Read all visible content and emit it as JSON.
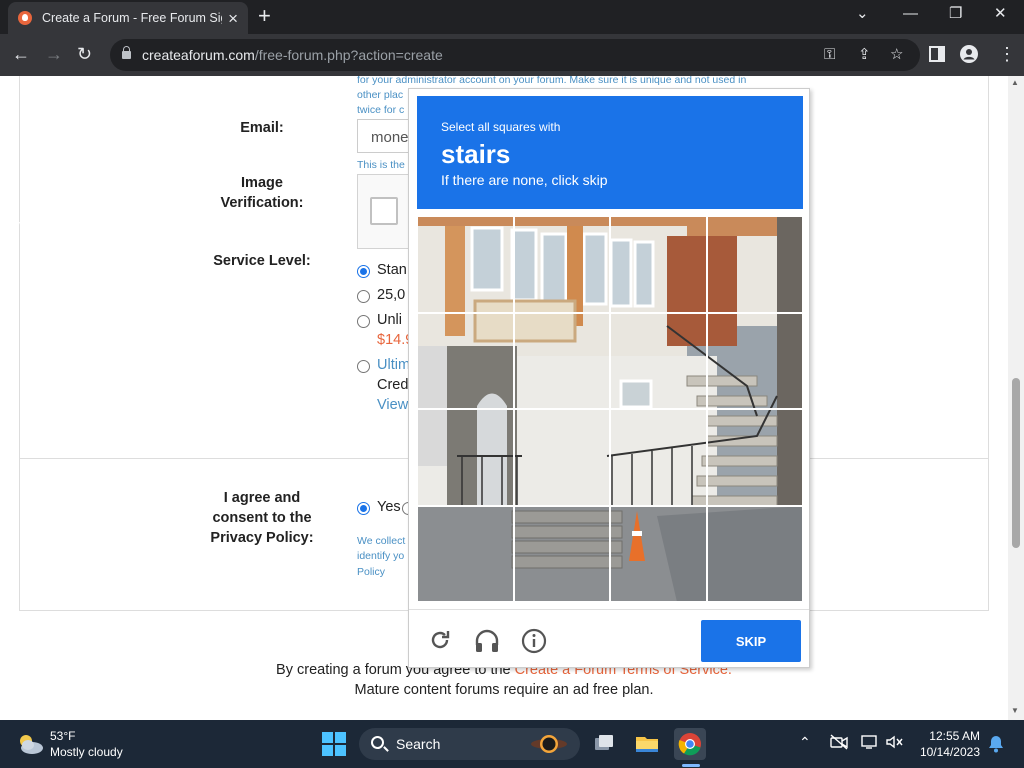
{
  "browser": {
    "tab_title": "Create a Forum - Free Forum Sig",
    "url_host": "createaforum.com",
    "url_path": "/free-forum.php?action=create"
  },
  "form": {
    "hint_admin": [
      "for your administrator account on your forum. Make sure it is unique and not used in",
      "other plac",
      "twice for c"
    ],
    "email_label": "Email:",
    "email_value": "mone",
    "email_hint": "This is the",
    "image_verification_label": [
      "Image",
      "Verification:"
    ],
    "service_level_label": "Service Level:",
    "options": {
      "standard": "Stan",
      "twentyfive": "25,0",
      "unlimited": "Unli",
      "unlimited_price": "$14.9",
      "ultimate": "Ultim",
      "ultimate_line2": "Cred",
      "ultimate_line3": "View"
    },
    "agree_label": [
      "I agree and",
      "consent to the",
      "Privacy Policy:"
    ],
    "agree_yes": "Yes",
    "privacy_hint": [
      "We collect",
      "identify yo",
      "Policy"
    ],
    "selected_service": "standard",
    "agree_selected": "yes"
  },
  "footer": {
    "line1_prefix": "By creating a forum you agree to the ",
    "line1_link": "Create a Forum Terms of Service.",
    "line2": "Mature content forums require an ad free plan."
  },
  "captcha": {
    "instruction_pre": "Select all squares with",
    "target_word": "stairs",
    "instruction_post": "If there are none, click skip",
    "skip_label": "SKIP",
    "accent": "#1a73e8"
  },
  "taskbar": {
    "temp": "53°F",
    "weather": "Mostly cloudy",
    "search_label": "Search",
    "time": "12:55 AM",
    "date": "10/14/2023"
  }
}
